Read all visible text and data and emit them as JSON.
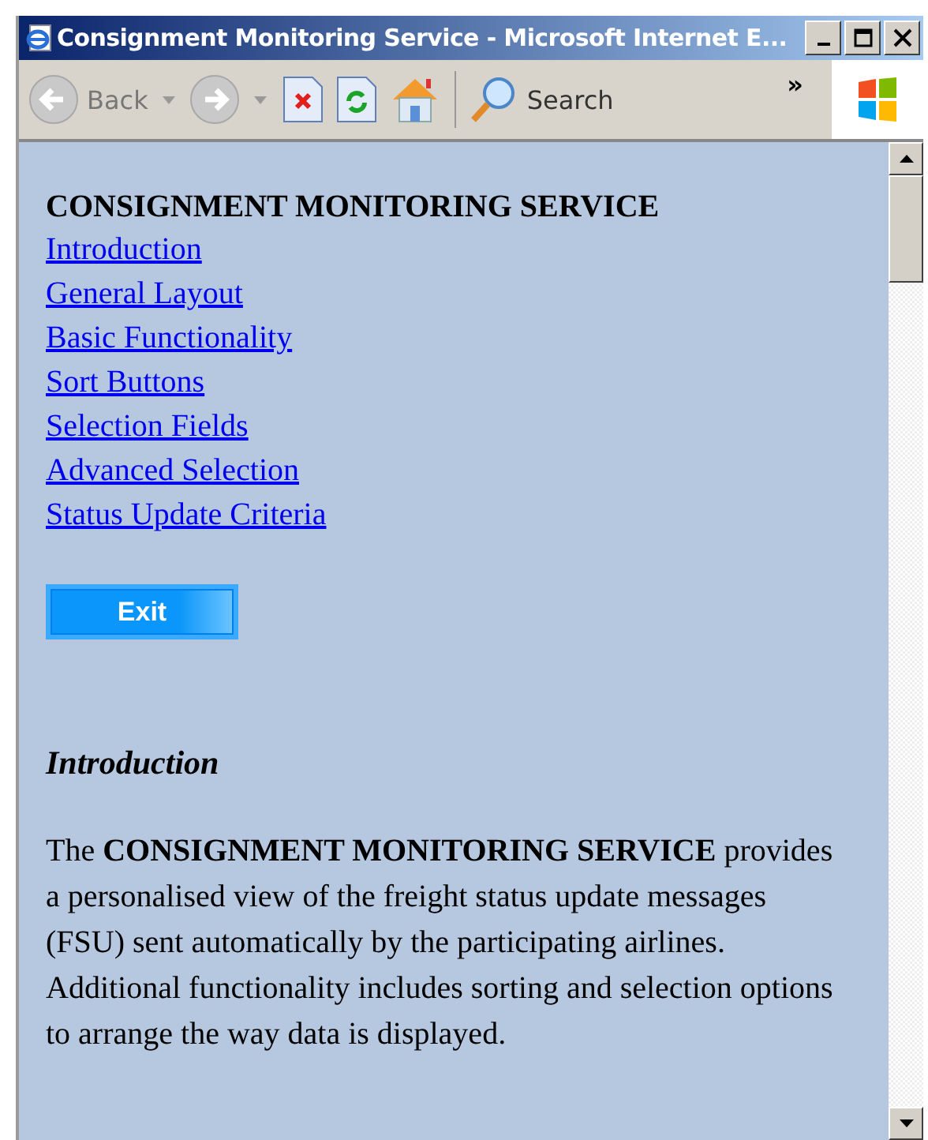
{
  "window": {
    "title": "Consignment Monitoring Service - Microsoft Internet E..."
  },
  "toolbar": {
    "back_label": "Back",
    "search_label": "Search",
    "overflow": "»"
  },
  "page": {
    "heading": "CONSIGNMENT MONITORING SERVICE",
    "links": [
      "Introduction",
      "General Layout",
      "Basic Functionality",
      "Sort Buttons",
      "Selection Fields",
      "Advanced Selection",
      "Status Update Criteria"
    ],
    "exit_button": "Exit",
    "section_title": "Introduction",
    "paragraph": "The **CONSIGNMENT MONITORING SERVICE** provides a personalised view of the freight status update messages (FSU) sent automatically by the participating airlines. Additional functionality includes sorting and selection options to arrange the way data is displayed."
  }
}
